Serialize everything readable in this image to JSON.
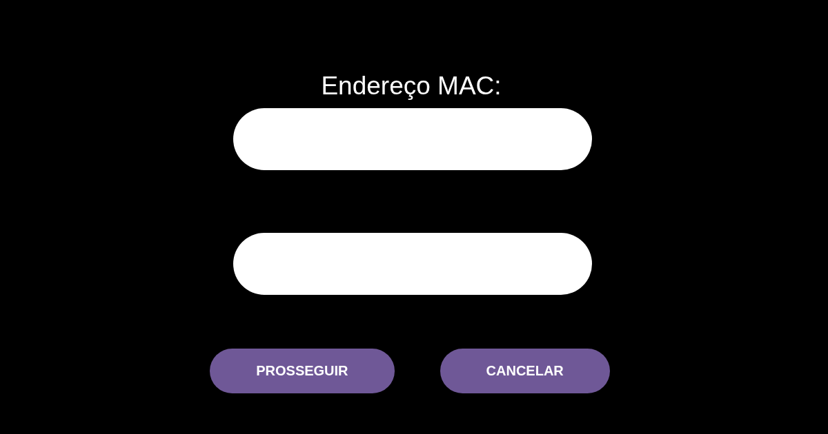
{
  "form": {
    "label": "Endereço MAC:",
    "fields": [
      {
        "kind": "input"
      },
      {
        "kind": "input"
      }
    ]
  },
  "buttons": [
    {
      "label": "PROSSEGUIR"
    },
    {
      "label": "CANCELAR"
    }
  ]
}
